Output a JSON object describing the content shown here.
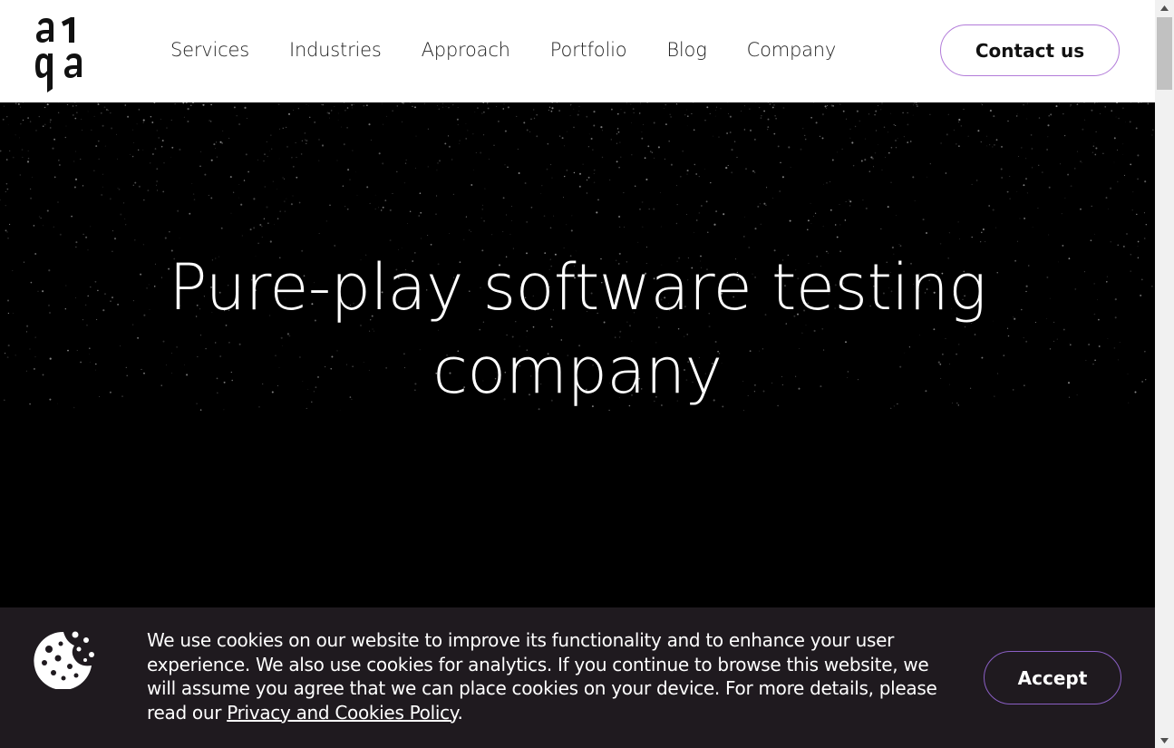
{
  "header": {
    "logo_text": "a1qa",
    "nav": [
      "Services",
      "Industries",
      "Approach",
      "Portfolio",
      "Blog",
      "Company"
    ],
    "contact_label": "Contact us"
  },
  "hero": {
    "title_line1": "Pure-play software testing",
    "title_line2": "company"
  },
  "cookie": {
    "text": "We use cookies on our website to improve its functionality and to enhance your user experience. We also use cookies for analytics. If you continue to browse this website, we will assume you agree that we can place cookies on your device. For more details, please read our ",
    "link_text": "Privacy and Cookies Policy",
    "text_end": ".",
    "accept_label": "Accept",
    "icon": "cookie-icon"
  },
  "colors": {
    "accent": "#b27bd9",
    "hero_bg": "#000000",
    "banner_bg": "#1f1a1f"
  }
}
